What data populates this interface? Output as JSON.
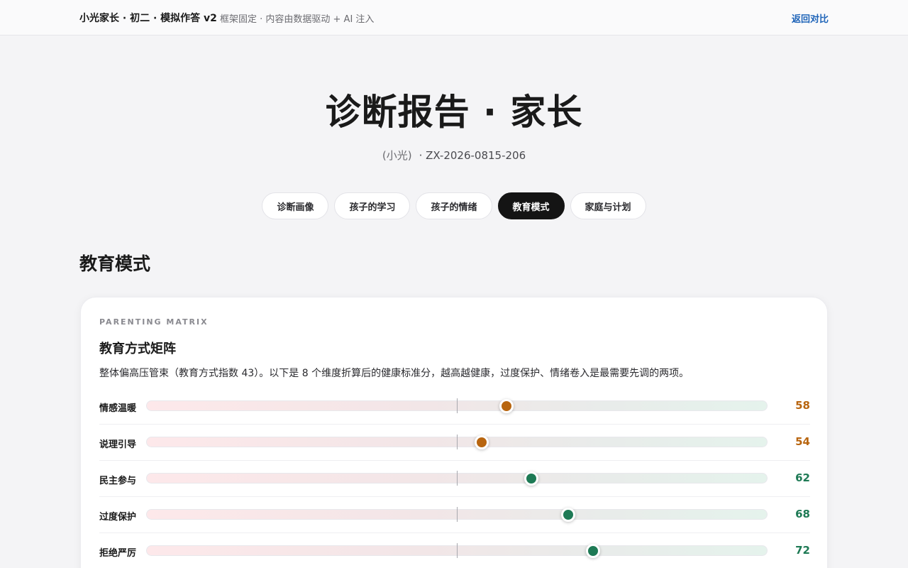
{
  "header": {
    "brand": "小光家长 · 初二 · 模拟作答 v2",
    "subtitle": "框架固定 · 内容由数据驱动 + AI 注入",
    "back_link": "返回对比"
  },
  "report": {
    "title": "诊断报告 · 家长",
    "name": "(小光)",
    "id": "· ZX-2026-0815-206"
  },
  "tabs": [
    {
      "label": "诊断画像",
      "active": false
    },
    {
      "label": "孩子的学习",
      "active": false
    },
    {
      "label": "孩子的情绪",
      "active": false
    },
    {
      "label": "教育模式",
      "active": true
    },
    {
      "label": "家庭与计划",
      "active": false
    }
  ],
  "section": {
    "title": "教育模式"
  },
  "matrix": {
    "eyebrow": "PARENTING MATRIX",
    "title": "教育方式矩阵",
    "description": "整体偏高压管束（教育方式指数 43）。以下是 8 个维度折算后的健康标准分，越高越健康，过度保护、情绪卷入是最需要先调的两项。",
    "colors": {
      "mid": "#b8650f",
      "good": "#1e7a55"
    },
    "rows": [
      {
        "label": "情感温暖",
        "score": 58,
        "level": "mid"
      },
      {
        "label": "说理引导",
        "score": 54,
        "level": "mid"
      },
      {
        "label": "民主参与",
        "score": 62,
        "level": "good"
      },
      {
        "label": "过度保护",
        "score": 68,
        "level": "good"
      },
      {
        "label": "拒绝严厉",
        "score": 72,
        "level": "good"
      }
    ]
  }
}
